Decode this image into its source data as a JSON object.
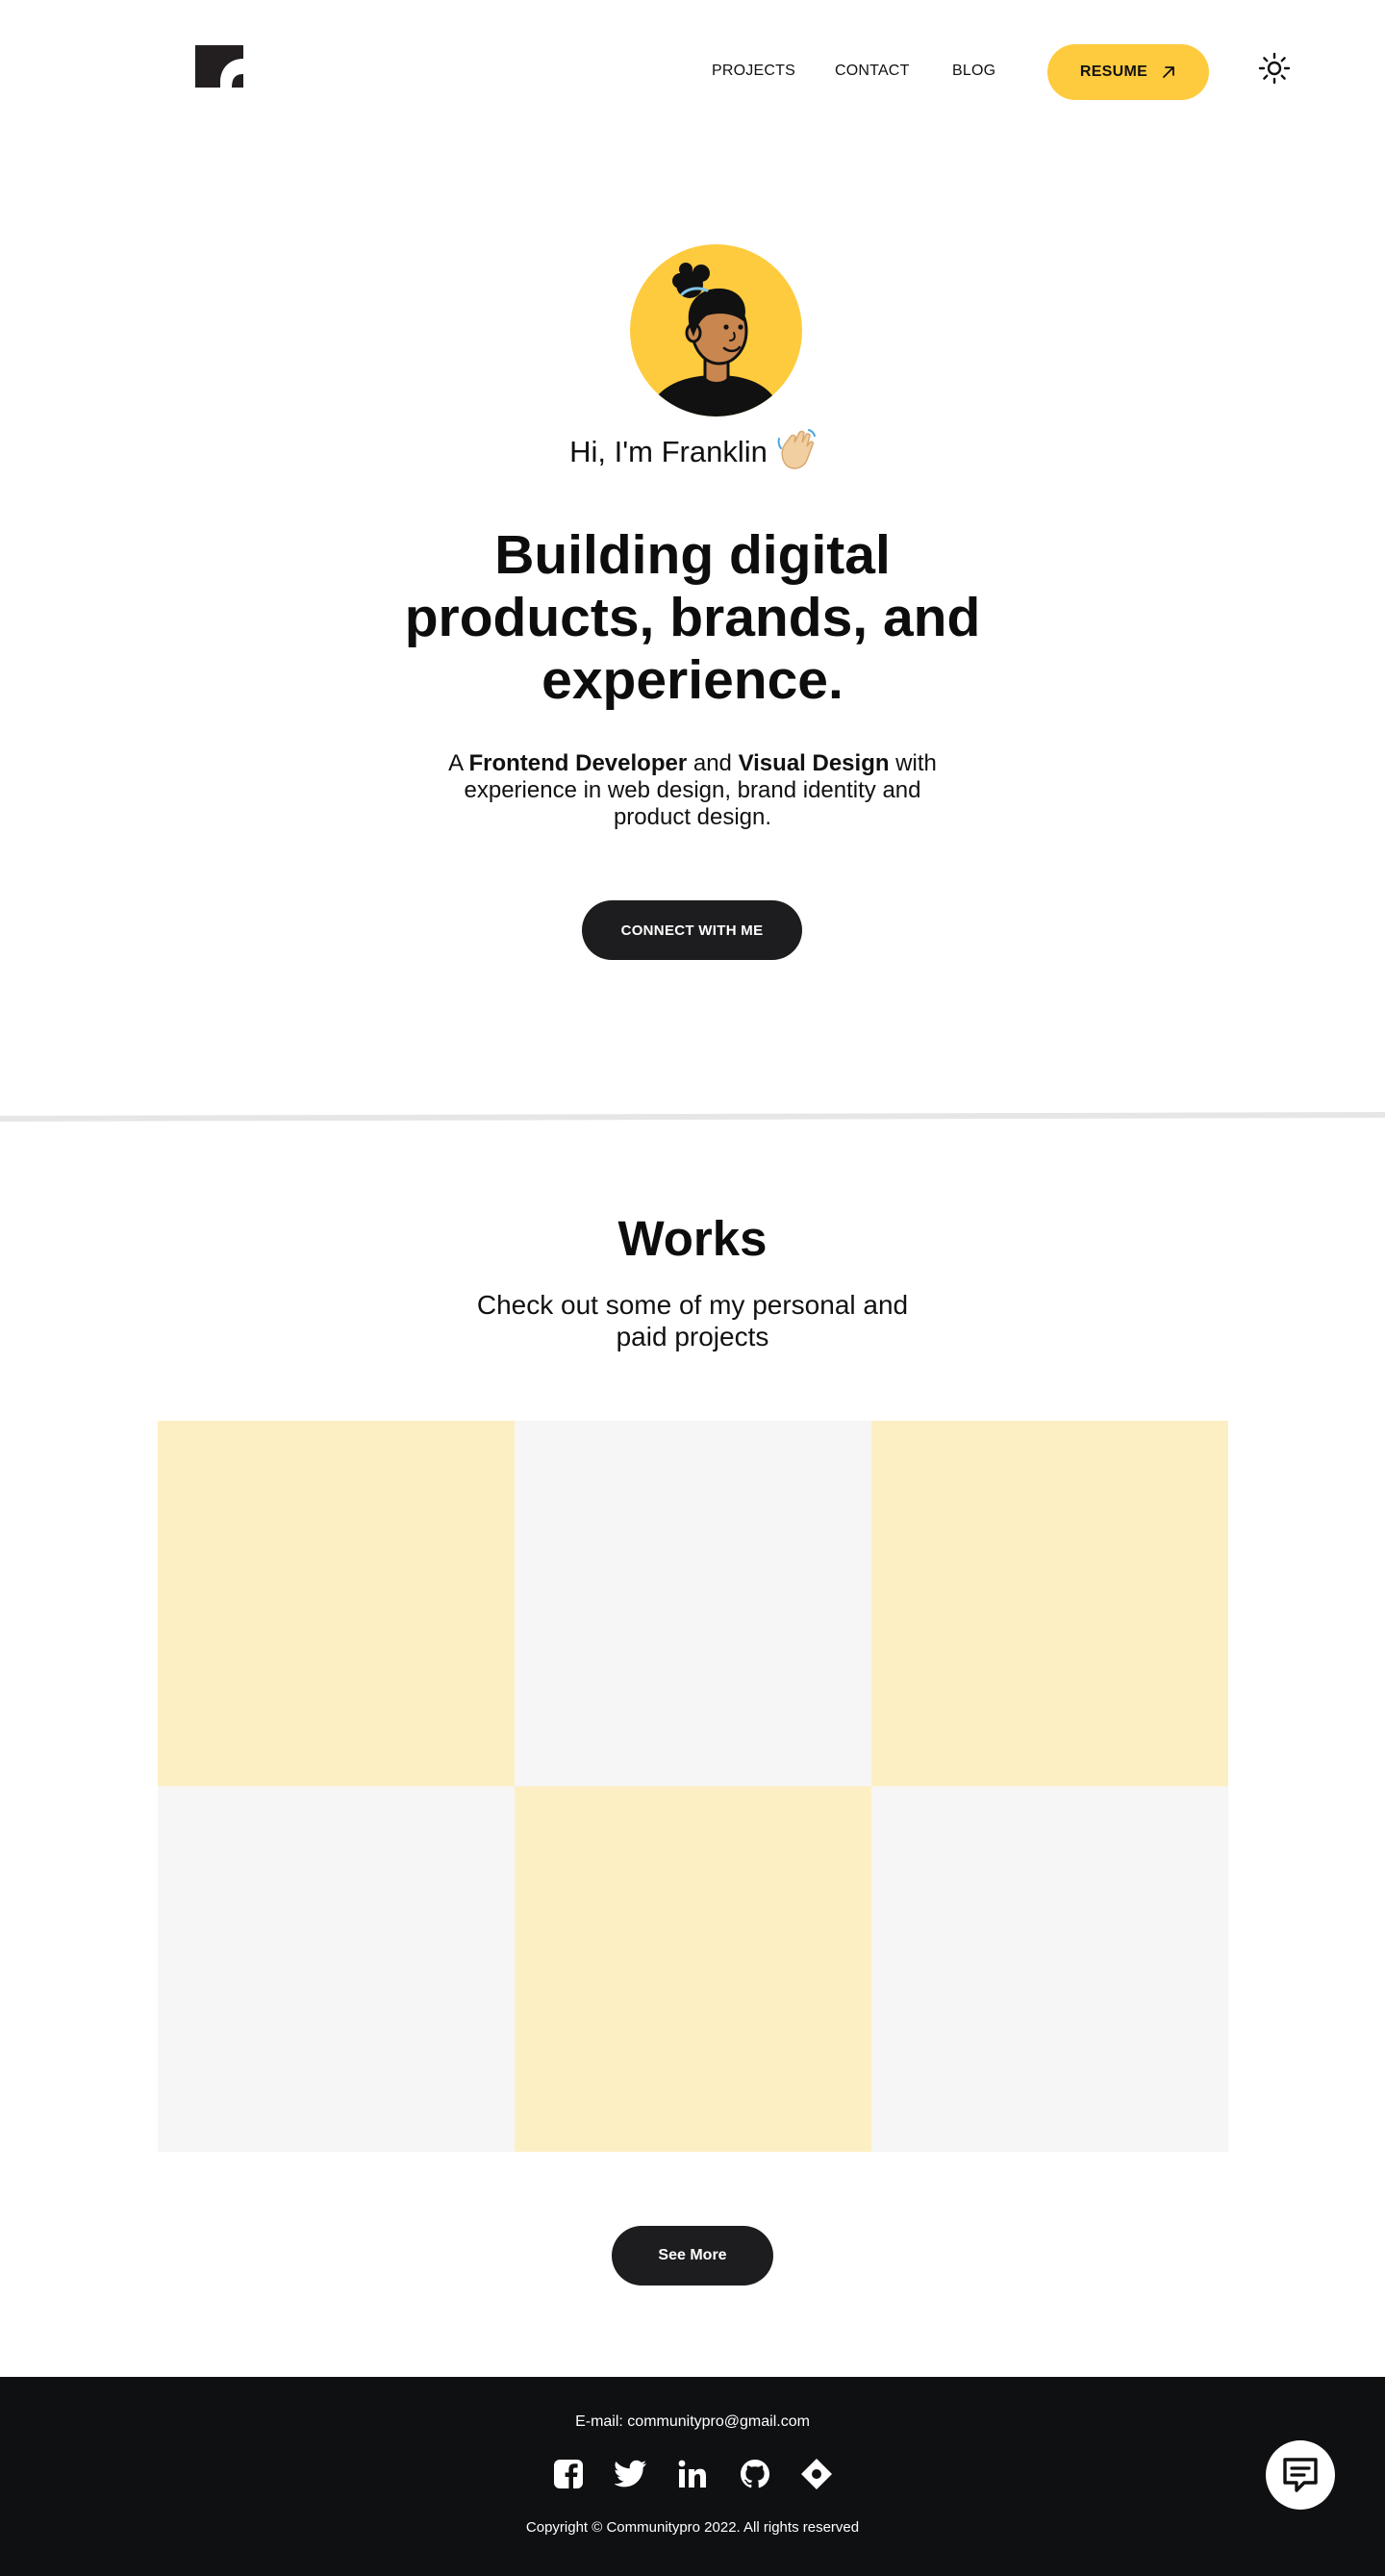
{
  "nav": {
    "links": [
      "PROJECTS",
      "CONTACT",
      "BLOG"
    ],
    "resume_label": "RESUME",
    "resume_icon": "arrow-up-right-icon",
    "theme_icon": "sun-icon"
  },
  "hero": {
    "greeting": "Hi, I'm Franklin",
    "wave_icon": "waving-hand-icon",
    "title": "Building digital products, brands, and experience.",
    "subtitle": {
      "prefix": "A ",
      "role1": "Frontend Developer",
      "mid": " and ",
      "role2": "Visual Design",
      "suffix": " with experience in web design, brand identity and product design."
    },
    "cta": "CONNECT WITH ME"
  },
  "works": {
    "title": "Works",
    "subtitle": "Check out some of my personal and paid projects",
    "see_more": "See More"
  },
  "footer": {
    "email": "E-mail: communitypro@gmail.com",
    "socials": [
      "facebook-icon",
      "twitter-icon",
      "linkedin-icon",
      "github-icon",
      "dribbble-icon"
    ],
    "copyright": "Copyright © Communitypro 2022. All rights reserved"
  },
  "colors": {
    "accent": "#fecb3e",
    "tile_yellow": "#fdefc4",
    "tile_gray": "#f6f6f6",
    "dark": "#1d1d1f",
    "footer_bg": "#0f1012"
  }
}
